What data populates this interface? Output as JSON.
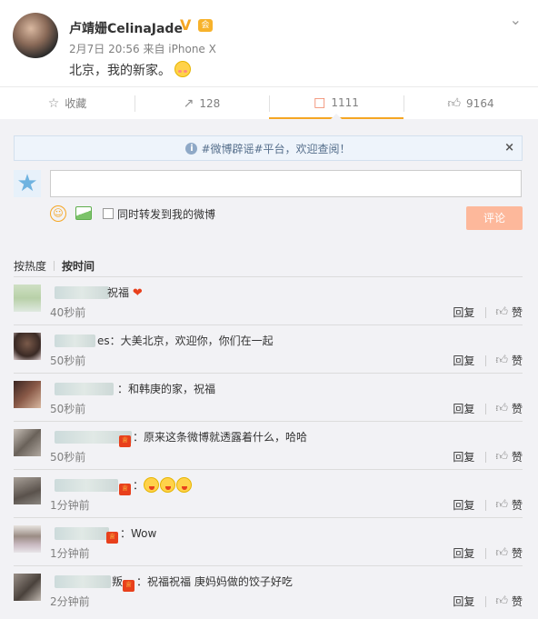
{
  "post": {
    "username": "卢靖姗CelinaJade",
    "verified_badge": "V",
    "vip_badge": "会",
    "meta": "2月7日 20:56 来自 iPhone X",
    "text": "北京，我的新家。",
    "emoji": "blush-face-emoji"
  },
  "actions": {
    "favorite": "收藏",
    "repost": "128",
    "comment": "1111",
    "like": "9164"
  },
  "notice": {
    "text": "#微博辟谣#平台，欢迎查阅！",
    "close": "×"
  },
  "composer": {
    "input_placeholder": "",
    "repost_label": "同时转发到我的微博",
    "submit_label": "评论"
  },
  "sort": {
    "hot": "按热度",
    "time": "按时间"
  },
  "comment_actions": {
    "reply": "回复",
    "like": "赞"
  },
  "comments": [
    {
      "name": "",
      "text": "祝福",
      "time": "40秒前",
      "emoji": "heart"
    },
    {
      "name": "es",
      "text": "：大美北京，欢迎你，你们在一起",
      "time": "50秒前"
    },
    {
      "name": "",
      "text": "：和韩庚的家，祝福",
      "time": "50秒前"
    },
    {
      "name": "",
      "text": "：原来这条微博就透露着什么，哈哈",
      "time": "50秒前",
      "vip": true
    },
    {
      "name": "",
      "text": "：",
      "time": "1分钟前",
      "vip": true,
      "emoji": "faces"
    },
    {
      "name": "",
      "text": "：Wow",
      "time": "1分钟前",
      "vip": true
    },
    {
      "name": "叛",
      "text": "：祝福祝福 庚妈妈做的饺子好吃",
      "time": "2分钟前",
      "vip": true
    }
  ],
  "colors": {
    "accent": "#f5a623",
    "submit_bg": "#fdb89b",
    "comment_area_bg": "#f2f2f5",
    "vip_red": "#e8401c"
  }
}
